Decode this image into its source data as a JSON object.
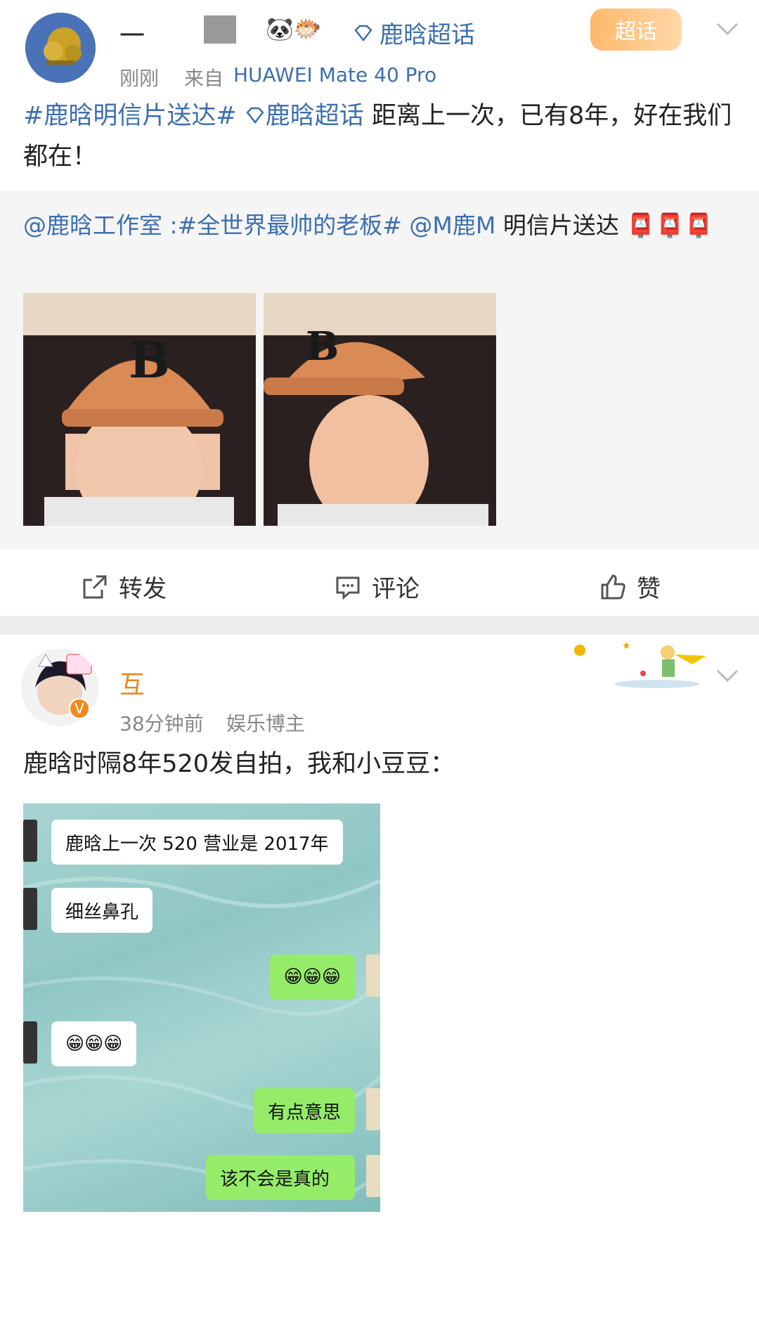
{
  "post1": {
    "username": "一",
    "super_topic": "鹿晗超话",
    "time": "刚刚",
    "source_prefix": "来自",
    "source_device": "HUAWEI Mate 40 Pro",
    "badge": "超话",
    "text_tag1": "#鹿晗明信片送达#",
    "text_topic": "鹿晗超话",
    "text_body": "距离上一次，已有8年，好在我们都在！",
    "repost_at": "@鹿晗工作室",
    "repost_tag": ":#全世界最帅的老板#",
    "repost_at2": "@M鹿M",
    "repost_body": "明信片送达",
    "actions": {
      "forward": "转发",
      "comment": "评论",
      "like": "赞"
    }
  },
  "post2": {
    "username": "互",
    "time": "38分钟前",
    "role": "娱乐博主",
    "text": "鹿晗时隔8年520发自拍，我和小豆豆：",
    "chat": [
      {
        "side": "left",
        "text": "鹿晗上一次 520 营业是 2017年"
      },
      {
        "side": "left",
        "text": "细丝鼻孔"
      },
      {
        "side": "right",
        "text": "😁😁😁"
      },
      {
        "side": "left",
        "text": "😁😁😁"
      },
      {
        "side": "right",
        "text": "有点意思"
      },
      {
        "side": "right",
        "text": "😁😁😁"
      },
      {
        "side": "right",
        "text": "该不会是真的"
      }
    ]
  },
  "colors": {
    "link_blue": "#3d6fb0",
    "bubble_green": "#95ec69",
    "cap_orange": "#d98a55"
  }
}
